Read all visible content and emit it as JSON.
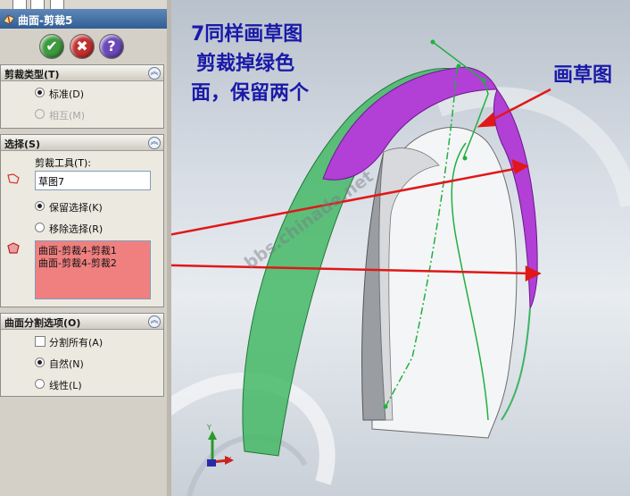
{
  "panel": {
    "title": "曲面-剪裁5",
    "groups": {
      "trim_type": {
        "header": "剪裁类型(T)",
        "options": [
          {
            "label": "标准(D)",
            "selected": true,
            "enabled": true
          },
          {
            "label": "相互(M)",
            "selected": false,
            "enabled": false
          }
        ]
      },
      "selection": {
        "header": "选择(S)",
        "tool_label": "剪裁工具(T):",
        "tool_value": "草图7",
        "options": [
          {
            "label": "保留选择(K)",
            "selected": true
          },
          {
            "label": "移除选择(R)",
            "selected": false
          }
        ],
        "list": [
          "曲面-剪裁4-剪裁1",
          "曲面-剪裁4-剪裁2"
        ]
      },
      "split": {
        "header": "曲面分割选项(O)",
        "checkbox": {
          "label": "分割所有(A)",
          "checked": false
        },
        "options": [
          {
            "label": "自然(N)",
            "selected": true
          },
          {
            "label": "线性(L)",
            "selected": false
          }
        ]
      }
    }
  },
  "annotations": {
    "note_left": [
      "7同样画草图",
      "剪裁掉绿色",
      "面，保留两个"
    ],
    "note_right": "画草图",
    "watermark": "bbs.chinade.net"
  },
  "triad": {
    "x": "X",
    "y": "Y"
  },
  "colors": {
    "magenta": "#b23fd6",
    "green": "#3fb366",
    "red": "#e01818",
    "note": "#1a1aa8",
    "list_bg": "#f08080"
  }
}
